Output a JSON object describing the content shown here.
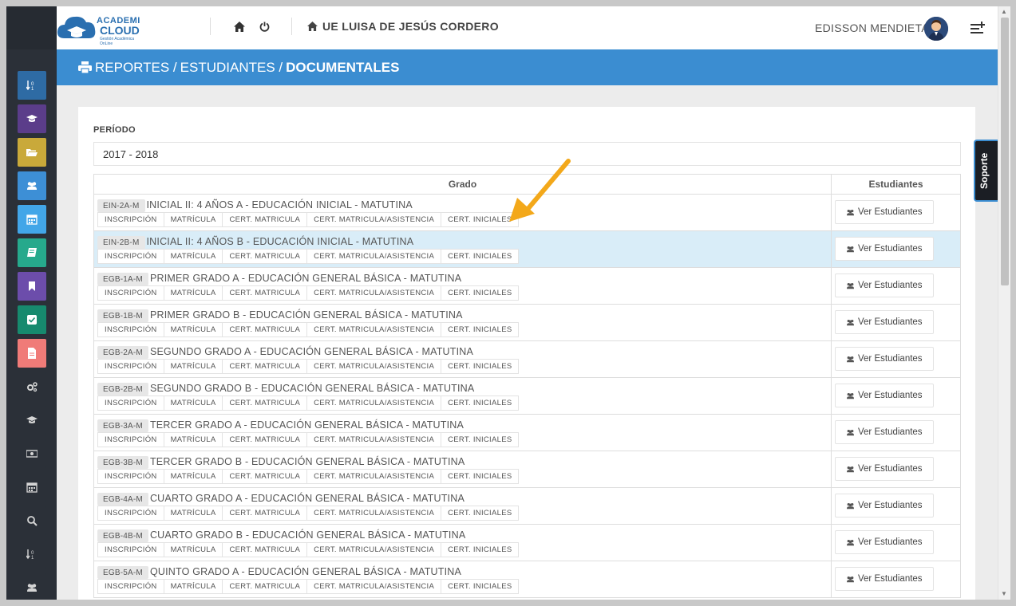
{
  "header": {
    "logo_line1": "ACADEMI",
    "logo_line2": "CLOUD",
    "logo_tagline": "Gestión Académica OnLine",
    "school_name": "UE LUISA DE JESÚS CORDERO",
    "user_name": "EDISSON MENDIETA"
  },
  "breadcrumb": {
    "part1": "REPORTES /",
    "part2": "ESTUDIANTES /",
    "part3": "DOCUMENTALES"
  },
  "period": {
    "label": "PERÍODO",
    "value": "2017 - 2018"
  },
  "table": {
    "col_grade": "Grado",
    "col_students": "Estudiantes",
    "doc_links": [
      "INSCRIPCIÓN",
      "MATRÍCULA",
      "CERT. MATRICULA",
      "CERT. MATRICULA/ASISTENCIA",
      "CERT. INICIALES"
    ],
    "button_label": "Ver Estudiantes",
    "rows": [
      {
        "code": "EIN-2A-M",
        "title": "INICIAL II: 4 AÑOS A - EDUCACIÓN INICIAL - MATUTINA"
      },
      {
        "code": "EIN-2B-M",
        "title": "INICIAL II: 4 AÑOS B - EDUCACIÓN INICIAL - MATUTINA"
      },
      {
        "code": "EGB-1A-M",
        "title": "PRIMER GRADO A - EDUCACIÓN GENERAL BÁSICA - MATUTINA"
      },
      {
        "code": "EGB-1B-M",
        "title": "PRIMER GRADO B - EDUCACIÓN GENERAL BÁSICA - MATUTINA"
      },
      {
        "code": "EGB-2A-M",
        "title": "SEGUNDO GRADO A - EDUCACIÓN GENERAL BÁSICA - MATUTINA"
      },
      {
        "code": "EGB-2B-M",
        "title": "SEGUNDO GRADO B - EDUCACIÓN GENERAL BÁSICA - MATUTINA"
      },
      {
        "code": "EGB-3A-M",
        "title": "TERCER GRADO A - EDUCACIÓN GENERAL BÁSICA - MATUTINA"
      },
      {
        "code": "EGB-3B-M",
        "title": "TERCER GRADO B - EDUCACIÓN GENERAL BÁSICA - MATUTINA"
      },
      {
        "code": "EGB-4A-M",
        "title": "CUARTO GRADO A - EDUCACIÓN GENERAL BÁSICA - MATUTINA"
      },
      {
        "code": "EGB-4B-M",
        "title": "CUARTO GRADO B - EDUCACIÓN GENERAL BÁSICA - MATUTINA"
      },
      {
        "code": "EGB-5A-M",
        "title": "QUINTO GRADO A - EDUCACIÓN GENERAL BÁSICA - MATUTINA"
      }
    ]
  },
  "support_tab": "Soporte",
  "sidebar": {
    "items": [
      {
        "icon": "sort-icon",
        "color": "#2e6ba4"
      },
      {
        "icon": "graduation-cap-icon",
        "color": "#5b3d8a"
      },
      {
        "icon": "folder-open-icon",
        "color": "#c9a93a"
      },
      {
        "icon": "users-icon",
        "color": "#3d8fd6"
      },
      {
        "icon": "calendar-icon",
        "color": "#42a6e8"
      },
      {
        "icon": "book-icon",
        "color": "#26a98c"
      },
      {
        "icon": "bookmark-icon",
        "color": "#6c4dab"
      },
      {
        "icon": "check-square-icon",
        "color": "#178a6e"
      },
      {
        "icon": "file-icon",
        "color": "#f07b78"
      },
      {
        "icon": "cogs-icon",
        "color": "#2b3038"
      },
      {
        "icon": "graduation-cap-icon",
        "color": "#2b3038"
      },
      {
        "icon": "money-icon",
        "color": "#2b3038"
      },
      {
        "icon": "calendar-icon",
        "color": "#2b3038"
      },
      {
        "icon": "search-icon",
        "color": "#2b3038"
      },
      {
        "icon": "sort-icon",
        "color": "#2b3038"
      },
      {
        "icon": "users-icon",
        "color": "#2b3038"
      }
    ]
  }
}
